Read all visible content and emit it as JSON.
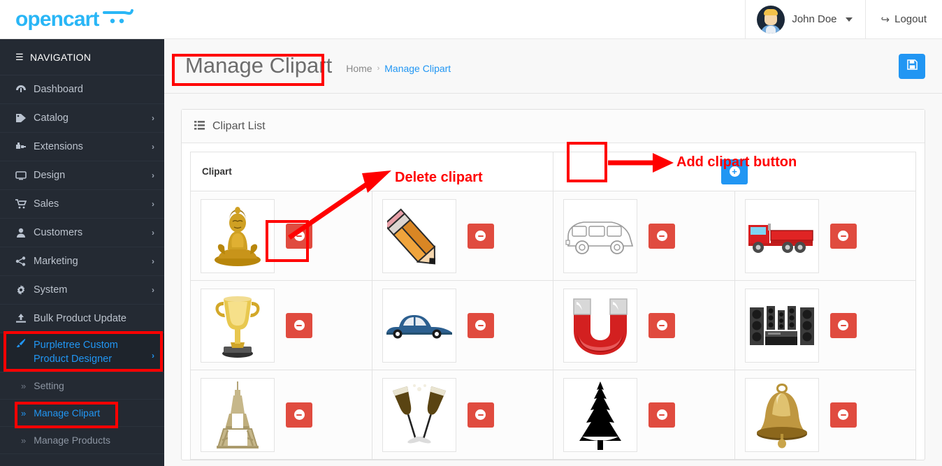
{
  "brand": {
    "name": "opencart",
    "cart_icon": "shopping-cart-icon"
  },
  "topbar": {
    "username": "John Doe",
    "user_caret": "chevron-down-icon",
    "logout_label": "Logout",
    "logout_icon": "logout-icon",
    "avatar_alt": "user-avatar"
  },
  "sidebar": {
    "nav_header": "NAVIGATION",
    "hamburger_icon": "hamburger-icon",
    "items": [
      {
        "label": "Dashboard",
        "icon": "dashboard-icon",
        "arrow": "",
        "active": false
      },
      {
        "label": "Catalog",
        "icon": "tag-icon",
        "arrow": "›",
        "active": false
      },
      {
        "label": "Extensions",
        "icon": "puzzle-icon",
        "arrow": "›",
        "active": false
      },
      {
        "label": "Design",
        "icon": "monitor-icon",
        "arrow": "›",
        "active": false
      },
      {
        "label": "Sales",
        "icon": "cart-icon",
        "arrow": "›",
        "active": false
      },
      {
        "label": "Customers",
        "icon": "user-icon",
        "arrow": "›",
        "active": false
      },
      {
        "label": "Marketing",
        "icon": "share-icon",
        "arrow": "›",
        "active": false
      },
      {
        "label": "System",
        "icon": "gear-icon",
        "arrow": "›",
        "active": false
      },
      {
        "label": "Bulk Product Update",
        "icon": "upload-icon",
        "arrow": "",
        "active": false
      },
      {
        "label": "Purpletree Custom Product Designer",
        "icon": "brush-icon",
        "arrow": "›",
        "active": true
      }
    ],
    "sub_items": [
      {
        "label": "Setting",
        "chev": "»",
        "active": false
      },
      {
        "label": "Manage Clipart",
        "chev": "»",
        "active": true
      },
      {
        "label": "Manage Products",
        "chev": "»",
        "active": false
      }
    ]
  },
  "page": {
    "title": "Manage Clipart",
    "breadcrumb": {
      "home": "Home",
      "separator": "›",
      "current": "Manage Clipart"
    },
    "save_button_icon": "save-icon"
  },
  "panel": {
    "header_title": "Clipart List",
    "header_icon": "list-icon",
    "column_header": "Clipart",
    "add_button_icon": "plus-circle-icon",
    "delete_button_icon": "minus-circle-icon"
  },
  "clipart_grid": {
    "columns": 4,
    "items": [
      {
        "name": "buddha-statue",
        "delete_label": "delete"
      },
      {
        "name": "pencil",
        "delete_label": "delete"
      },
      {
        "name": "minivan-outline",
        "delete_label": "delete"
      },
      {
        "name": "red-flatbed-truck",
        "delete_label": "delete"
      },
      {
        "name": "gold-trophy",
        "delete_label": "delete"
      },
      {
        "name": "blue-classic-car",
        "delete_label": "delete"
      },
      {
        "name": "horseshoe-magnet",
        "delete_label": "delete"
      },
      {
        "name": "home-theater-speakers",
        "delete_label": "delete"
      },
      {
        "name": "eiffel-tower",
        "delete_label": "delete"
      },
      {
        "name": "champagne-glasses-toast",
        "delete_label": "delete"
      },
      {
        "name": "pine-tree-silhouette",
        "delete_label": "delete"
      },
      {
        "name": "golden-bell",
        "delete_label": "delete"
      }
    ]
  },
  "annotations": {
    "colors": {
      "marker": "#ff0000",
      "accent_blue": "#2196f3",
      "delete_red": "#e04b3f"
    },
    "labels": [
      {
        "id": "delete-clipart",
        "text": "Delete clipart"
      },
      {
        "id": "add-clipart-button",
        "text": "Add clipart button"
      }
    ]
  }
}
